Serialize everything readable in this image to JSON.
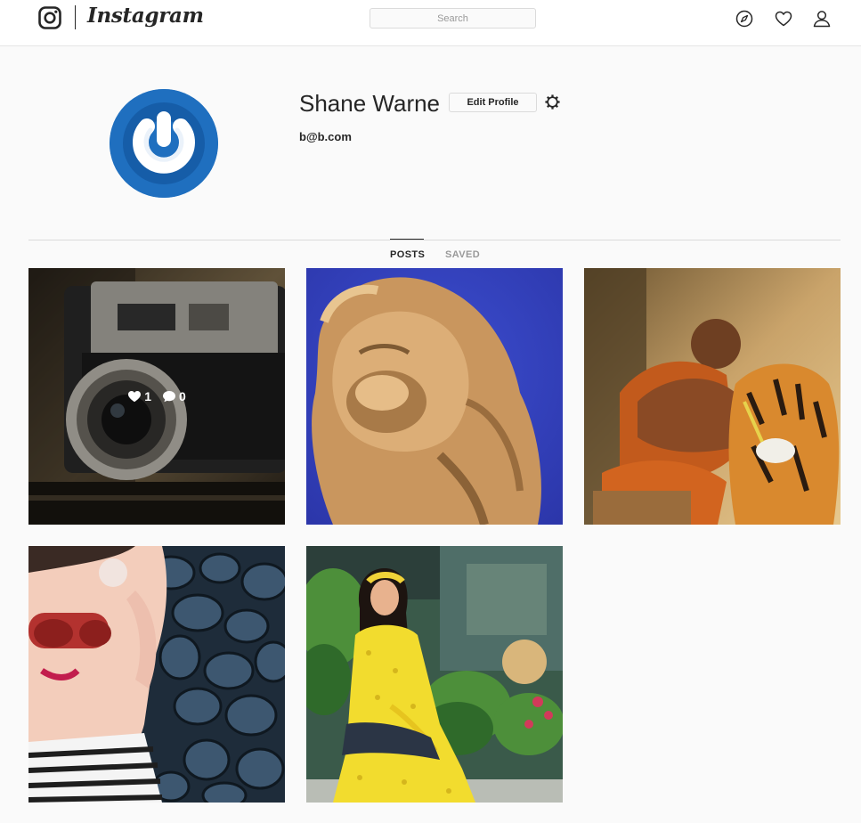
{
  "nav": {
    "brand": "Instagram",
    "search_placeholder": "Search"
  },
  "profile": {
    "username": "Shane Warne",
    "edit_label": "Edit Profile",
    "email": "b@b.com"
  },
  "tabs": [
    {
      "label": "POSTS",
      "active": true
    },
    {
      "label": "SAVED",
      "active": false
    }
  ],
  "posts": [
    {
      "subject": "camera",
      "likes": "1",
      "comments": "0",
      "hovered": true
    },
    {
      "subject": "lion-statue"
    },
    {
      "subject": "monk-tiger"
    },
    {
      "subject": "woman-sunglasses"
    },
    {
      "subject": "woman-yellow-dress"
    }
  ],
  "colors": {
    "avatar_bg": "#1f6fbf",
    "border": "#dbdbdb",
    "text": "#262626",
    "muted": "#999999"
  }
}
